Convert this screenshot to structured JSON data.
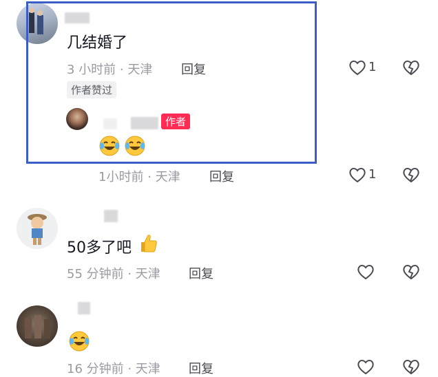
{
  "comments": [
    {
      "text": "几结婚了",
      "meta": "3 小时前 · 天津",
      "reply_label": "回复",
      "like_count": "1",
      "liked_badge": "作者赞过"
    },
    {
      "author_tag": "作者",
      "meta": "1小时前 · 天津",
      "reply_label": "回复",
      "like_count": "1"
    },
    {
      "text": "50多了吧",
      "meta": "55 分钟前 · 天津",
      "reply_label": "回复"
    },
    {
      "meta": "16 分钟前 · 天津",
      "reply_label": "回复"
    }
  ],
  "colors": {
    "highlight": "#3a5dc7",
    "author_tag": "#fe2c55"
  },
  "icons": [
    "heart-icon",
    "dislike-heart-icon",
    "laugh-cry-emoji",
    "thumbs-up-emoji"
  ]
}
